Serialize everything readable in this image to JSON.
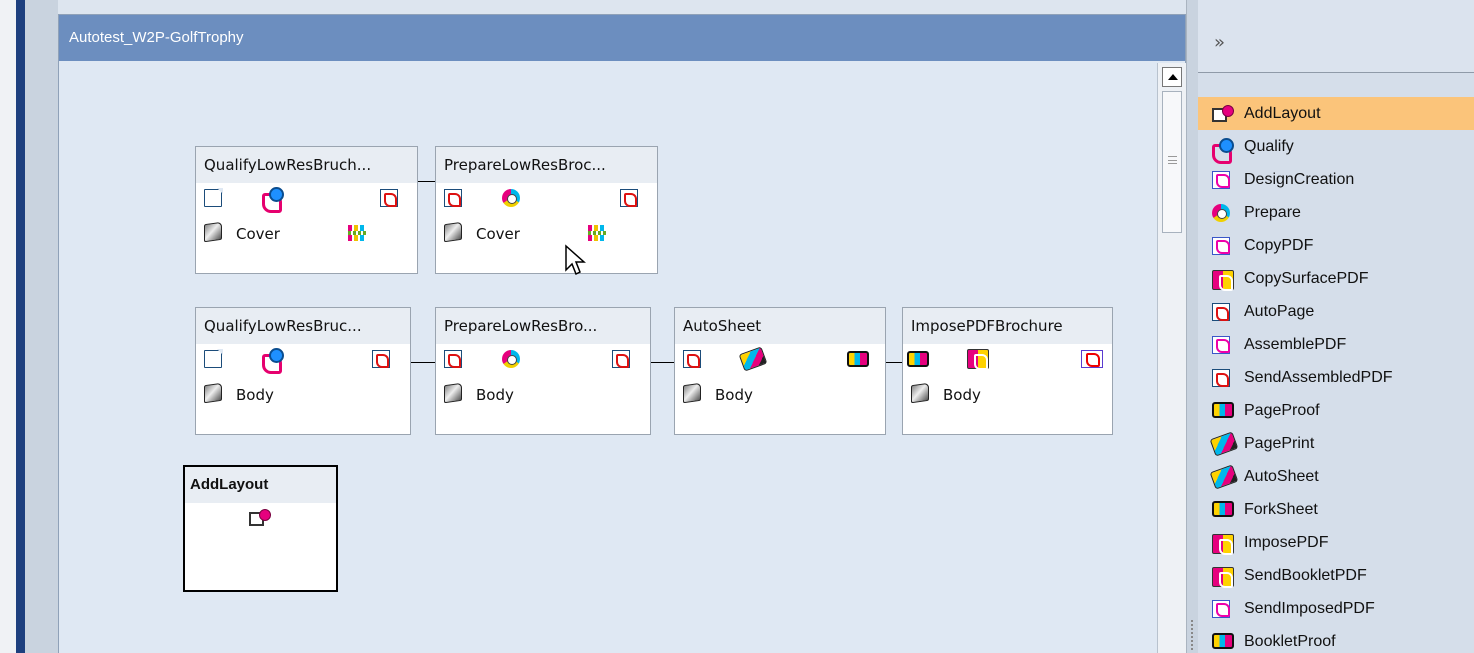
{
  "editor": {
    "title": "Autotest_W2P-GolfTrophy"
  },
  "workflow": {
    "row1": [
      {
        "title": "QualifyLowResBruch...",
        "part": "Cover"
      },
      {
        "title": "PrepareLowResBroc...",
        "part": "Cover"
      }
    ],
    "row2": [
      {
        "title": "QualifyLowResBruc...",
        "part": "Body"
      },
      {
        "title": "PrepareLowResBro...",
        "part": "Body"
      },
      {
        "title": "AutoSheet",
        "part": "Body"
      },
      {
        "title": "ImposePDFBrochure",
        "part": "Body"
      }
    ],
    "selected_node": {
      "title": "AddLayout"
    }
  },
  "panel": {
    "expand_glyph": "»",
    "items": [
      {
        "label": "AddLayout",
        "icon": "add-layout-icon",
        "active": true
      },
      {
        "label": "Qualify",
        "icon": "qualify-icon"
      },
      {
        "label": "DesignCreation",
        "icon": "design-creation-icon"
      },
      {
        "label": "Prepare",
        "icon": "prepare-icon"
      },
      {
        "label": "CopyPDF",
        "icon": "copy-pdf-icon"
      },
      {
        "label": "CopySurfacePDF",
        "icon": "copy-surface-pdf-icon"
      },
      {
        "label": "AutoPage",
        "icon": "auto-page-icon"
      },
      {
        "label": "AssemblePDF",
        "icon": "assemble-pdf-icon"
      },
      {
        "label": "SendAssembledPDF",
        "icon": "send-assembled-pdf-icon"
      },
      {
        "label": "PageProof",
        "icon": "page-proof-icon"
      },
      {
        "label": "PagePrint",
        "icon": "page-print-icon"
      },
      {
        "label": "AutoSheet",
        "icon": "auto-sheet-icon"
      },
      {
        "label": "ForkSheet",
        "icon": "fork-sheet-icon"
      },
      {
        "label": "ImposePDF",
        "icon": "impose-pdf-icon"
      },
      {
        "label": "SendBookletPDF",
        "icon": "send-booklet-pdf-icon"
      },
      {
        "label": "SendImposedPDF",
        "icon": "send-imposed-pdf-icon"
      },
      {
        "label": "BookletProof",
        "icon": "booklet-proof-icon"
      }
    ]
  },
  "colors": {
    "title_bar": "#6c8ebf",
    "active_item": "#fbc47a",
    "accent_strip": "#1d3f7e"
  }
}
